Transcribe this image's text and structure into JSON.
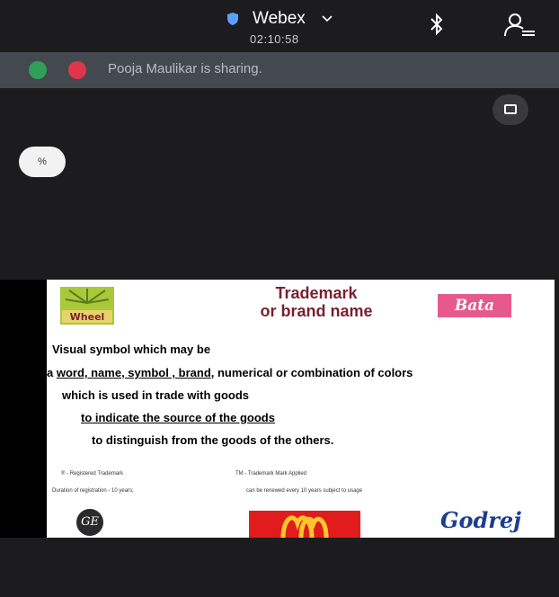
{
  "header": {
    "app_title": "Webex",
    "timer": "02:10:58",
    "icons": {
      "shield": "shield-icon",
      "dropdown": "chevron-down-icon",
      "bluetooth": "bluetooth-icon",
      "participants": "participants-icon"
    }
  },
  "share_bar": {
    "text": "Pooja Maulikar is sharing.",
    "colors": {
      "green": "#2f9e57",
      "red": "#e0364a"
    }
  },
  "avatar": {
    "initials": "%"
  },
  "pip_button": {
    "icon": "pip-icon"
  },
  "slide": {
    "title_line1": "Trademark",
    "title_line2": "or brand name",
    "logos": {
      "top_left": "Wheel",
      "top_right": "Bata",
      "bottom_left": "GE",
      "bottom_right": "Godrej"
    },
    "line1": "Visual symbol which may be",
    "line2_prefix": "a ",
    "line2_underlined": "word, name, symbol , brand",
    "line2_suffix": ", numerical or combination of colors",
    "line3": "which is used in trade with goods",
    "line4": "to indicate the source of the goods",
    "line5": "to distinguish from the goods of the others.",
    "note_r": "®  -  Registered Trademark",
    "note_tm": "TM  -  Trademark Mark Applied",
    "note_duration": "Duration of registration - 10 years;",
    "note_renew": "can be renewed every 10 years subject to usage",
    "colors": {
      "title": "#7a1f2f",
      "bata": "#e55a8b",
      "mcdonalds": "#e01c1c",
      "godrej": "#1b3e8f"
    }
  }
}
